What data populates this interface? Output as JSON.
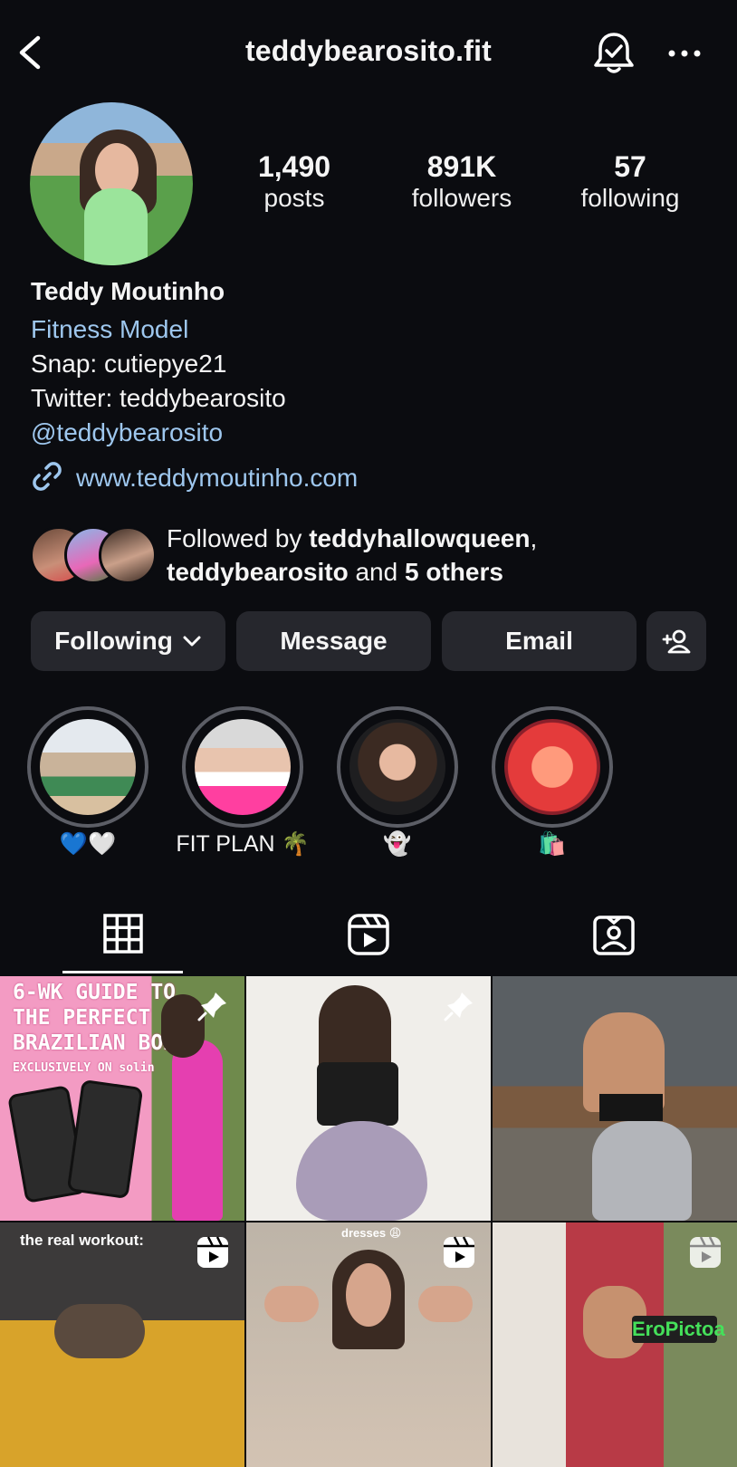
{
  "header": {
    "username": "teddybearosito.fit"
  },
  "stats": [
    {
      "value": "1,490",
      "label": "posts"
    },
    {
      "value": "891K",
      "label": "followers"
    },
    {
      "value": "57",
      "label": "following"
    }
  ],
  "bio": {
    "name": "Teddy Moutinho",
    "category": "Fitness Model",
    "line1": "Snap: cutiepye21",
    "line2": "Twitter: teddybearosito",
    "mention": "@teddybearosito",
    "link": "www.teddymoutinho.com"
  },
  "followed_by": {
    "prefix": "Followed by ",
    "user1": "teddyhallowqueen",
    "comma": ",",
    "user2": "teddybearosito",
    "and": " and ",
    "others": "5 others"
  },
  "actions": {
    "following": "Following",
    "message": "Message",
    "email": "Email"
  },
  "highlights": [
    {
      "label": "💙🤍"
    },
    {
      "label": "FIT PLAN 🌴"
    },
    {
      "label": "👻"
    },
    {
      "label": "🛍️"
    }
  ],
  "tabs": [
    "grid",
    "reels",
    "tagged"
  ],
  "posts": {
    "p1": {
      "line1": "6-WK GUIDE TO",
      "line2": "THE PERFECT",
      "line3": "BRAZILIAN BODY",
      "line4": "EXCLUSIVELY ON solin"
    },
    "p4": {
      "caption": "the real workout:"
    },
    "p5": {
      "caption": "dresses 😩"
    }
  },
  "watermark": "EroPictoa",
  "colors": {
    "background": "#0b0c10",
    "link": "#9ec7ee",
    "button": "#26272d"
  }
}
